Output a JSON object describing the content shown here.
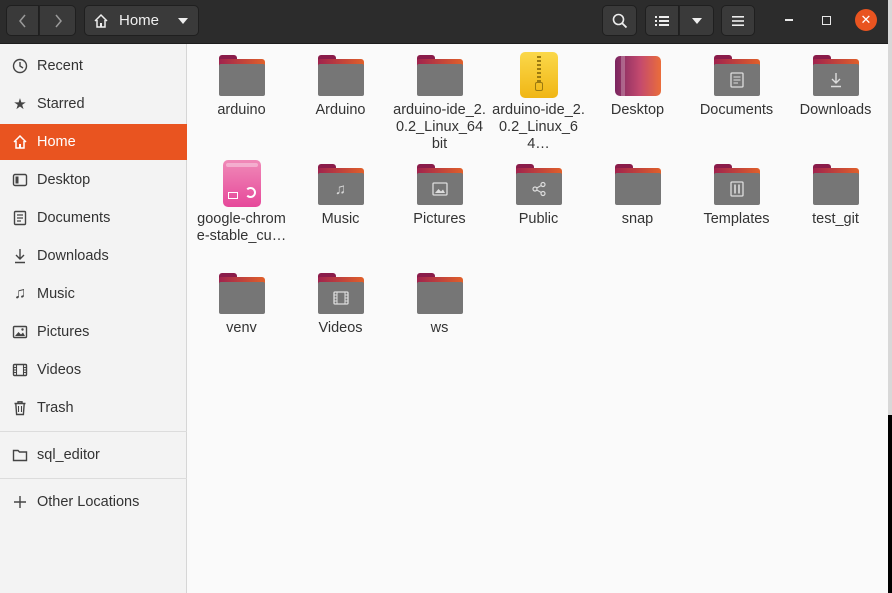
{
  "header": {
    "path_label": "Home"
  },
  "sidebar": {
    "items": [
      {
        "label": "Recent",
        "icon": "clock-icon"
      },
      {
        "label": "Starred",
        "icon": "star-icon"
      },
      {
        "label": "Home",
        "icon": "home-icon",
        "active": true
      },
      {
        "label": "Desktop",
        "icon": "desktop-icon"
      },
      {
        "label": "Documents",
        "icon": "document-icon"
      },
      {
        "label": "Downloads",
        "icon": "download-icon"
      },
      {
        "label": "Music",
        "icon": "music-icon"
      },
      {
        "label": "Pictures",
        "icon": "picture-icon"
      },
      {
        "label": "Videos",
        "icon": "video-icon"
      },
      {
        "label": "Trash",
        "icon": "trash-icon"
      }
    ],
    "bookmarks": [
      {
        "label": "sql_editor",
        "icon": "folder-icon"
      }
    ],
    "other": {
      "label": "Other Locations",
      "icon": "plus-icon"
    }
  },
  "files": [
    {
      "name": "arduino",
      "type": "folder"
    },
    {
      "name": "Arduino",
      "type": "folder"
    },
    {
      "name": "arduino-ide_2.0.2_Linux_64bit",
      "type": "folder"
    },
    {
      "name": "arduino-ide_2.0.2_Linux_64…",
      "type": "zip"
    },
    {
      "name": "Desktop",
      "type": "desktop"
    },
    {
      "name": "Documents",
      "type": "folder",
      "emblem": "document-icon"
    },
    {
      "name": "Downloads",
      "type": "folder",
      "emblem": "download-icon"
    },
    {
      "name": "google-chrome-stable_cu…",
      "type": "deb"
    },
    {
      "name": "Music",
      "type": "folder",
      "emblem": "music-icon"
    },
    {
      "name": "Pictures",
      "type": "folder",
      "emblem": "picture-icon"
    },
    {
      "name": "Public",
      "type": "folder",
      "emblem": "share-icon"
    },
    {
      "name": "snap",
      "type": "folder"
    },
    {
      "name": "Templates",
      "type": "folder",
      "emblem": "template-icon"
    },
    {
      "name": "test_git",
      "type": "folder"
    },
    {
      "name": "venv",
      "type": "folder"
    },
    {
      "name": "Videos",
      "type": "folder",
      "emblem": "video-icon"
    },
    {
      "name": "ws",
      "type": "folder"
    }
  ],
  "colors": {
    "accent": "#e95420",
    "headerbar": "#2c2c2c",
    "folder_body": "#767676"
  }
}
